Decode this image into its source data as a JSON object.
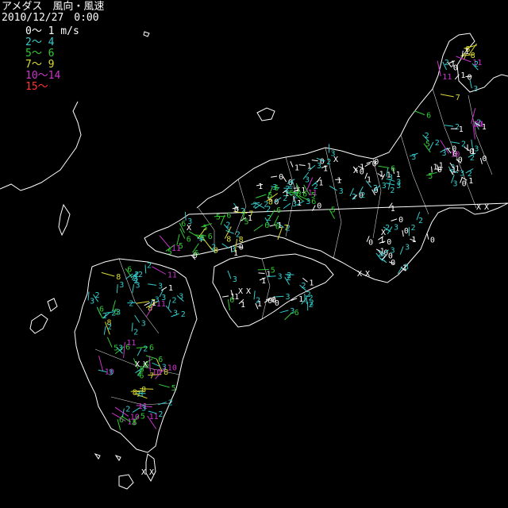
{
  "title": "アメダス　風向・風速",
  "timestamp": "2010/12/27　0:00",
  "legend": [
    {
      "label": "0～ 1 m/s",
      "color": "#ffffff"
    },
    {
      "label": "2～ 4",
      "color": "#33cccc"
    },
    {
      "label": "5～ 6",
      "color": "#33cc33"
    },
    {
      "label": "7～ 9",
      "color": "#dddd33"
    },
    {
      "label": "10～14",
      "color": "#cc33cc"
    },
    {
      "label": "15～",
      "color": "#ff3333"
    }
  ],
  "colors": {
    "background": "#000000",
    "coastline": "#ffffff"
  },
  "missing_marker": "X"
}
